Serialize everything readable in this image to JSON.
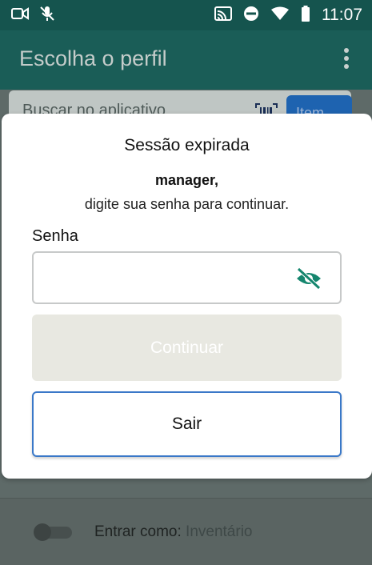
{
  "status_bar": {
    "time": "11:07"
  },
  "app_bar": {
    "title": "Escolha o perfil"
  },
  "search": {
    "placeholder": "Buscar no aplicativo",
    "filter_label": "Item"
  },
  "dialog": {
    "title": "Sessão expirada",
    "user": "manager,",
    "message": "digite sua senha para continuar.",
    "password_label": "Senha",
    "password_value": "",
    "continue_label": "Continuar",
    "exit_label": "Sair"
  },
  "bottom": {
    "enter_as_label": "Entrar como:",
    "enter_as_value": "Inventário",
    "toggle_on": false
  },
  "colors": {
    "primary": "#1a5d57",
    "accent": "#15866e",
    "outline_blue": "#3a78c8"
  }
}
